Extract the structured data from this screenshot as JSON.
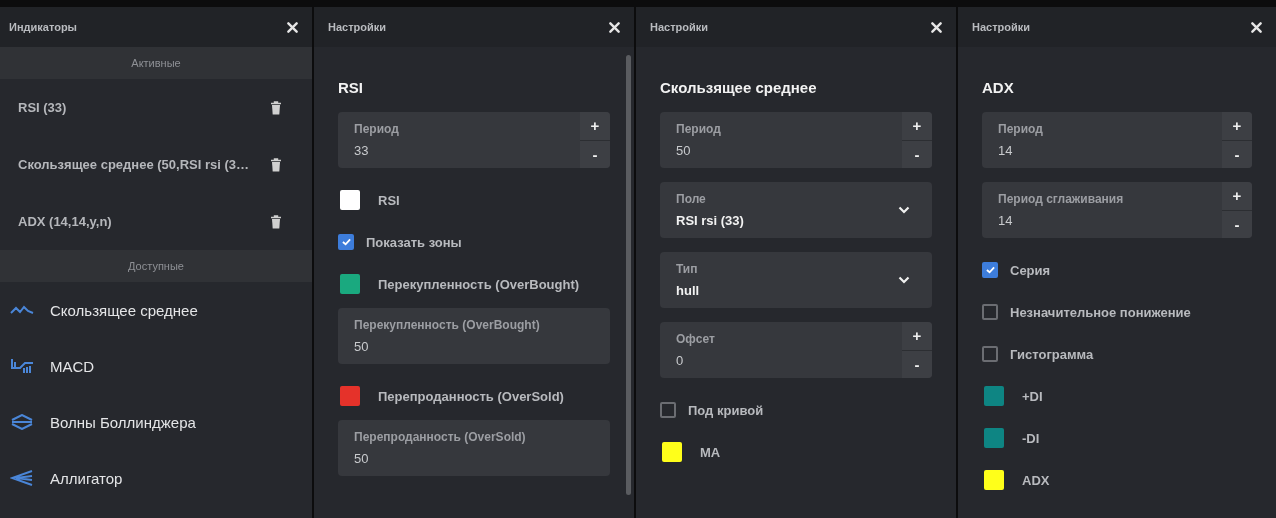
{
  "indicators_panel": {
    "title": "Индикаторы",
    "active_header": "Активные",
    "active": [
      {
        "label": "RSI (33)"
      },
      {
        "label": "Скользящее среднее (50,RSI rsi (3…"
      },
      {
        "label": "ADX (14,14,y,n)"
      }
    ],
    "available_header": "Доступные",
    "available": [
      {
        "label": "Скользящее среднее",
        "kind": "wave"
      },
      {
        "label": "MACD",
        "kind": "bars"
      },
      {
        "label": "Волны Боллинджера",
        "kind": "bands"
      },
      {
        "label": "Аллигатор",
        "kind": "jaws"
      }
    ]
  },
  "settings_panels": [
    {
      "title": "Настройки",
      "heading": "RSI",
      "scrollbar": true,
      "controls": [
        {
          "kind": "stepper",
          "label": "Период",
          "value": "33",
          "increment": "+",
          "decrement": "-"
        },
        {
          "kind": "color",
          "label": "RSI",
          "color": "#ffffff"
        },
        {
          "kind": "checkbox",
          "label": "Показать зоны",
          "checked": true
        },
        {
          "kind": "color",
          "label": "Перекупленность (OverBought)",
          "color": "#1aa97f"
        },
        {
          "kind": "number",
          "label": "Перекупленность (OverBought)",
          "value": "50"
        },
        {
          "kind": "color",
          "label": "Перепроданность (OverSold)",
          "color": "#e5322a"
        },
        {
          "kind": "number",
          "label": "Перепроданность (OverSold)",
          "value": "50"
        }
      ]
    },
    {
      "title": "Настройки",
      "heading": "Скользящее среднее",
      "scrollbar": false,
      "controls": [
        {
          "kind": "stepper",
          "label": "Период",
          "value": "50",
          "increment": "+",
          "decrement": "-"
        },
        {
          "kind": "select",
          "label": "Поле",
          "value": "RSI rsi (33)"
        },
        {
          "kind": "select",
          "label": "Тип",
          "value": "hull"
        },
        {
          "kind": "stepper",
          "label": "Офсет",
          "value": "0",
          "increment": "+",
          "decrement": "-"
        },
        {
          "kind": "checkbox",
          "label": "Под кривой",
          "checked": false
        },
        {
          "kind": "color",
          "label": "MA",
          "color": "#ffff1a"
        }
      ]
    },
    {
      "title": "Настройки",
      "heading": "ADX",
      "scrollbar": false,
      "controls": [
        {
          "kind": "stepper",
          "label": "Период",
          "value": "14",
          "increment": "+",
          "decrement": "-"
        },
        {
          "kind": "stepper",
          "label": "Период сглаживания",
          "value": "14",
          "increment": "+",
          "decrement": "-"
        },
        {
          "kind": "checkbox",
          "label": "Серия",
          "checked": true
        },
        {
          "kind": "checkbox",
          "label": "Незначительное понижение",
          "checked": false
        },
        {
          "kind": "checkbox",
          "label": "Гистограмма",
          "checked": false
        },
        {
          "kind": "color",
          "label": "+DI",
          "color": "#0e8583"
        },
        {
          "kind": "color",
          "label": "-DI",
          "color": "#0e8583"
        },
        {
          "kind": "color",
          "label": "ADX",
          "color": "#ffff1a"
        }
      ]
    }
  ]
}
